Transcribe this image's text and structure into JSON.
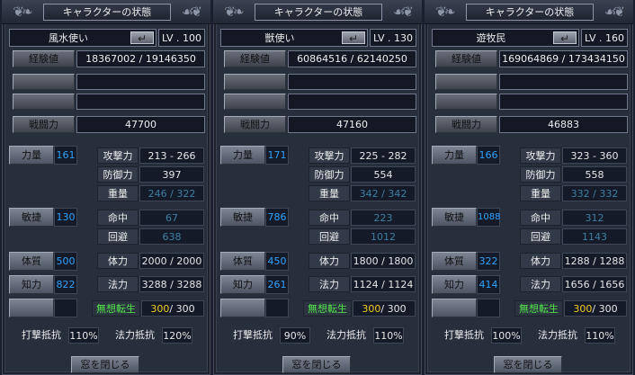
{
  "panels": [
    {
      "title": "キャラクターの状態",
      "name": "風水使い",
      "enter_icon": "↵",
      "level": "LV . 100",
      "exp_label": "経験値",
      "exp": "18367002 / 19146350",
      "power_label": "戦闘力",
      "power": "47700",
      "str_label": "力量",
      "str": "161",
      "dex_label": "敏捷",
      "dex": "130",
      "con_label": "体質",
      "con": "500",
      "int_label": "知力",
      "int": "822",
      "atk_label": "攻撃力",
      "atk": "213 - 266",
      "def_label": "防御力",
      "def": "397",
      "wt_label": "重量",
      "wt": "246 / 322",
      "hit_label": "命中",
      "hit": "67",
      "eva_label": "回避",
      "eva": "638",
      "hp_label": "体力",
      "hp": "2000 / 2000",
      "mp_label": "法力",
      "mp": "3288 / 3288",
      "rebirth_label": "無想転生",
      "rebirth_cur": "300",
      "rebirth_max": "/ 300",
      "phys_res_label": "打撃抵抗",
      "phys_res": "110%",
      "mag_res_label": "法力抵抗",
      "mag_res": "120%",
      "close_label": "窓を閉じる"
    },
    {
      "title": "キャラクターの状態",
      "name": "獣使い",
      "enter_icon": "↵",
      "level": "LV . 130",
      "exp_label": "経験値",
      "exp": "60864516 / 62140250",
      "power_label": "戦闘力",
      "power": "47160",
      "str_label": "力量",
      "str": "171",
      "dex_label": "敏捷",
      "dex": "786",
      "con_label": "体質",
      "con": "450",
      "int_label": "知力",
      "int": "261",
      "atk_label": "攻撃力",
      "atk": "225 - 282",
      "def_label": "防御力",
      "def": "554",
      "wt_label": "重量",
      "wt": "342 / 342",
      "hit_label": "命中",
      "hit": "223",
      "eva_label": "回避",
      "eva": "1012",
      "hp_label": "体力",
      "hp": "1800 / 1800",
      "mp_label": "法力",
      "mp": "1124 / 1124",
      "rebirth_label": "無想転生",
      "rebirth_cur": "300",
      "rebirth_max": "/ 300",
      "phys_res_label": "打撃抵抗",
      "phys_res": "90%",
      "mag_res_label": "法力抵抗",
      "mag_res": "110%",
      "close_label": "窓を閉じる"
    },
    {
      "title": "キャラクターの状態",
      "name": "遊牧民",
      "enter_icon": "↵",
      "level": "LV . 160",
      "exp_label": "経験値",
      "exp": "169064869 / 173434150",
      "power_label": "戦闘力",
      "power": "46883",
      "str_label": "力量",
      "str": "166",
      "dex_label": "敏捷",
      "dex": "1088",
      "con_label": "体質",
      "con": "322",
      "int_label": "知力",
      "int": "414",
      "atk_label": "攻撃力",
      "atk": "323 - 360",
      "def_label": "防御力",
      "def": "558",
      "wt_label": "重量",
      "wt": "332 / 332",
      "hit_label": "命中",
      "hit": "312",
      "eva_label": "回避",
      "eva": "1143",
      "hp_label": "体力",
      "hp": "1288 / 1288",
      "mp_label": "法力",
      "mp": "1656 / 1656",
      "rebirth_label": "無想転生",
      "rebirth_cur": "300",
      "rebirth_max": "/ 300",
      "phys_res_label": "打撃抵抗",
      "phys_res": "100%",
      "mag_res_label": "法力抵抗",
      "mag_res": "110%",
      "close_label": "窓を閉じる"
    }
  ],
  "colors": {
    "stat_value": "#2ea3ff",
    "dim_value": "#3e7fa3",
    "rebirth_label": "#53e64a",
    "rebirth_value": "#f2cc22"
  }
}
